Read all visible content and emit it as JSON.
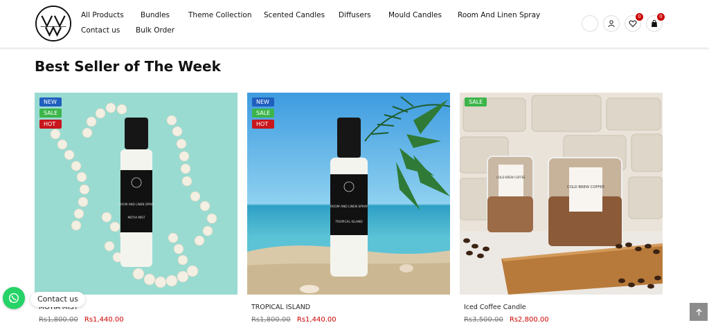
{
  "header": {
    "logo_label": "logo",
    "nav": [
      {
        "label": "All Products"
      },
      {
        "label": "Bundles"
      },
      {
        "label": "Theme Collection"
      },
      {
        "label": "Scented Candles"
      },
      {
        "label": "Diffusers"
      },
      {
        "label": "Mould Candles"
      },
      {
        "label": "Room And Linen Spray"
      },
      {
        "label": "Contact us"
      },
      {
        "label": "Bulk Order"
      }
    ],
    "icons": {
      "search": "search-icon",
      "account": "user-icon",
      "wishlist": "heart-icon",
      "cart": "bag-icon"
    },
    "wishlist_count": "0",
    "cart_count": "0"
  },
  "section": {
    "title": "Best Seller of The Week"
  },
  "products": [
    {
      "name": "MOTIA MIST",
      "old_price": "Rs1,800.00",
      "new_price": "Rs1,440.00",
      "badges": [
        "NEW",
        "SALE",
        "HOT"
      ],
      "bottle_label": "ROOM AND LINEN SPRAY",
      "bottle_sub": "MOTIA MIST"
    },
    {
      "name": "TROPICAL ISLAND",
      "old_price": "Rs1,800.00",
      "new_price": "Rs1,440.00",
      "badges": [
        "NEW",
        "SALE",
        "HOT"
      ],
      "bottle_label": "ROOM AND LINEN SPRAY",
      "bottle_sub": "TROPICAL ISLAND"
    },
    {
      "name": "Iced Coffee Candle",
      "old_price": "Rs3,500.00",
      "new_price": "Rs2,800.00",
      "badges": [
        "SALE"
      ],
      "jar_label": "COLD BREW COFFEE"
    }
  ],
  "badge_colors": {
    "NEW": "#1f5fbf",
    "SALE": "#3cb54a",
    "HOT": "#c8161d"
  },
  "whatsapp": {
    "label": "Contact us",
    "color": "#25d366"
  },
  "colors": {
    "price": "#cc0000",
    "count_badge": "#cc0000"
  }
}
